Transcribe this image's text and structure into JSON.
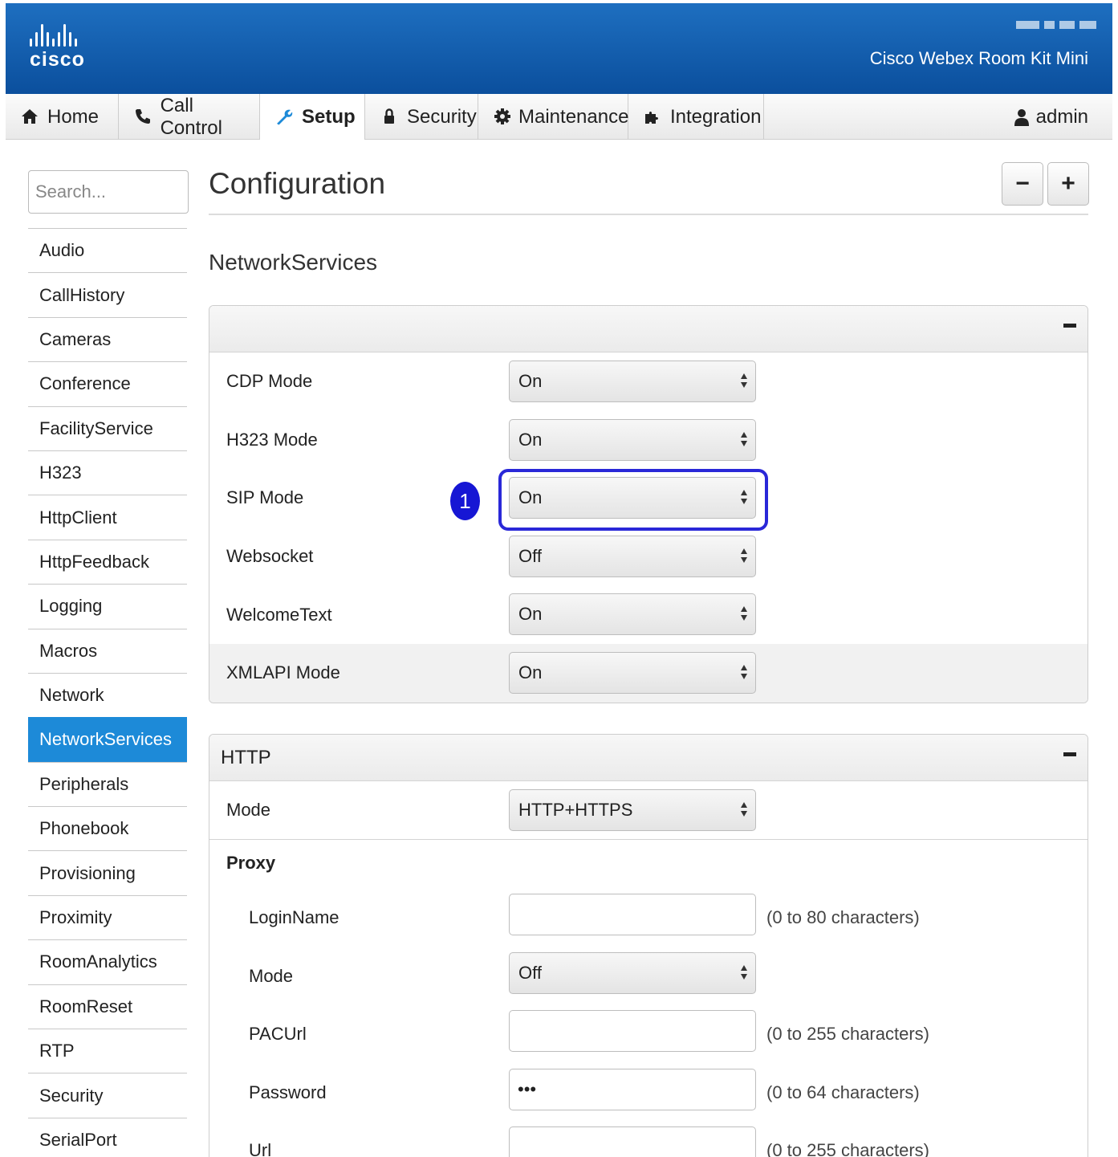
{
  "header": {
    "logo_text": "cisco",
    "product_name": "Cisco Webex Room Kit Mini"
  },
  "nav": {
    "tabs": [
      {
        "label": "Home",
        "icon": "home-icon"
      },
      {
        "label": "Call Control",
        "icon": "phone-icon"
      },
      {
        "label": "Setup",
        "icon": "wrench-icon",
        "active": true
      },
      {
        "label": "Security",
        "icon": "lock-icon"
      },
      {
        "label": "Maintenance",
        "icon": "gear-icon"
      },
      {
        "label": "Integration",
        "icon": "puzzle-icon"
      }
    ],
    "user": "admin"
  },
  "sidebar": {
    "search_placeholder": "Search...",
    "items": [
      "Audio",
      "CallHistory",
      "Cameras",
      "Conference",
      "FacilityService",
      "H323",
      "HttpClient",
      "HttpFeedback",
      "Logging",
      "Macros",
      "Network",
      "NetworkServices",
      "Peripherals",
      "Phonebook",
      "Provisioning",
      "Proximity",
      "RoomAnalytics",
      "RoomReset",
      "RTP",
      "Security",
      "SerialPort"
    ],
    "active": "NetworkServices"
  },
  "main": {
    "title": "Configuration",
    "zoom_out": "−",
    "zoom_in": "+",
    "section": "NetworkServices",
    "panel1": {
      "rows": [
        {
          "label": "CDP Mode",
          "value": "On"
        },
        {
          "label": "H323 Mode",
          "value": "On"
        },
        {
          "label": "SIP Mode",
          "value": "On"
        },
        {
          "label": "Websocket",
          "value": "Off"
        },
        {
          "label": "WelcomeText",
          "value": "On"
        },
        {
          "label": "XMLAPI Mode",
          "value": "On"
        }
      ]
    },
    "panel2": {
      "title": "HTTP",
      "mode_label": "Mode",
      "mode_value": "HTTP+HTTPS",
      "proxy_label": "Proxy",
      "proxy_rows": [
        {
          "label": "LoginName",
          "type": "text",
          "value": "",
          "hint": "(0 to 80 characters)"
        },
        {
          "label": "Mode",
          "type": "select",
          "value": "Off",
          "hint": ""
        },
        {
          "label": "PACUrl",
          "type": "text",
          "value": "",
          "hint": "(0 to 255 characters)"
        },
        {
          "label": "Password",
          "type": "text",
          "value": "•••",
          "hint": "(0 to 64 characters)"
        },
        {
          "label": "Url",
          "type": "text",
          "value": "",
          "hint": "(0 to 255 characters)"
        }
      ]
    }
  },
  "annotation": {
    "marker": "1"
  },
  "colors": {
    "header": "#0b4f9d",
    "active_sidebar": "#1d8ad8",
    "highlight": "#2a28d8"
  }
}
